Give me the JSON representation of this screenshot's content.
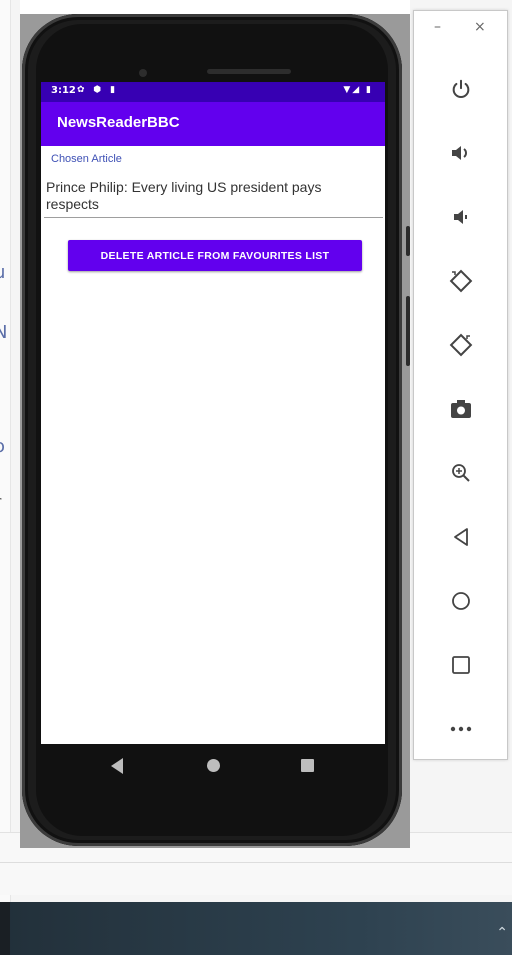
{
  "statusbar": {
    "time": "3:12",
    "left_icons": "✿ ⬢ ▮",
    "right_icons": "▼◢ ▮"
  },
  "app": {
    "title": "NewsReaderBBC"
  },
  "content": {
    "chosen_label": "Chosen Article",
    "article_title": "Prince Philip: Every living US president pays respects",
    "delete_button": "DELETE ARTICLE FROM FAVOURITES LIST"
  },
  "toolbar": {
    "minimize": "–",
    "close": "×",
    "items": [
      "power-icon",
      "volume-up-icon",
      "volume-down-icon",
      "rotate-left-icon",
      "rotate-right-icon",
      "camera-icon",
      "zoom-icon",
      "back-icon",
      "home-icon",
      "overview-icon",
      "more-icon"
    ]
  },
  "ide_fragments": [
    "u",
    "N",
    "o",
    "r"
  ],
  "colors": {
    "primary": "#6200ee",
    "primary_dark": "#3700b3",
    "label": "#3f51b5"
  }
}
